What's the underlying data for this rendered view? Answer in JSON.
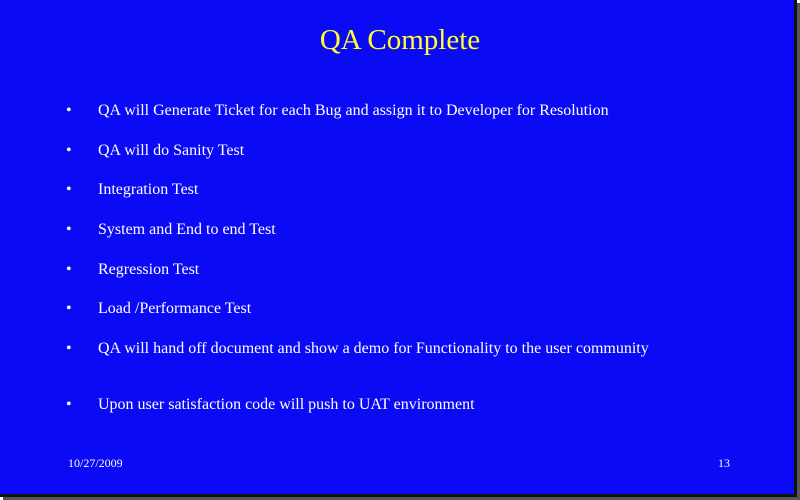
{
  "slide": {
    "title": "QA Complete",
    "bullet_symbol": "•",
    "bullets": [
      "QA will Generate Ticket for each Bug and assign it to Developer for Resolution",
      "QA will do Sanity Test",
      "Integration Test",
      "System and End to end Test",
      "Regression Test",
      "Load /Performance Test",
      "QA will hand off document and show a demo for Functionality to the user community",
      "Upon user satisfaction code will push to UAT environment"
    ],
    "footer_date": "10/27/2009",
    "page_number": "13"
  },
  "colors": {
    "background": "#0a0af5",
    "title": "#ffff33",
    "text": "#ffffff"
  }
}
